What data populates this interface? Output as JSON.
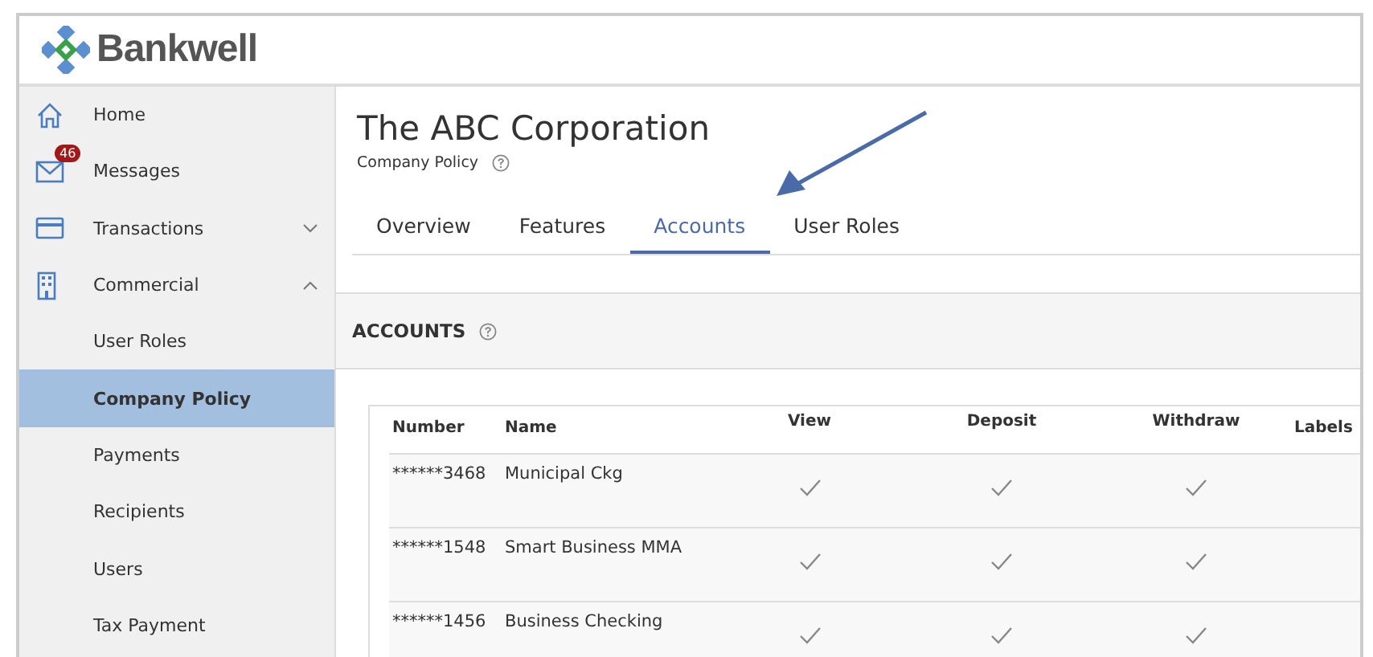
{
  "brand": {
    "name": "Bankwell"
  },
  "sidebar": {
    "items": [
      {
        "label": "Home",
        "kind": "home",
        "selected": false
      },
      {
        "label": "Messages",
        "kind": "mail",
        "badge": "46",
        "selected": false
      },
      {
        "label": "Transactions",
        "kind": "card",
        "expanded": false,
        "selected": false
      },
      {
        "label": "Commercial",
        "kind": "building",
        "expanded": true,
        "selected": false
      },
      {
        "label": "User Roles",
        "kind": "sub",
        "selected": false
      },
      {
        "label": "Company Policy",
        "kind": "sub",
        "selected": true
      },
      {
        "label": "Payments",
        "kind": "sub",
        "selected": false
      },
      {
        "label": "Recipients",
        "kind": "sub",
        "selected": false
      },
      {
        "label": "Users",
        "kind": "sub",
        "selected": false
      },
      {
        "label": "Tax Payment",
        "kind": "sub",
        "selected": false
      }
    ]
  },
  "page": {
    "title": "The ABC Corporation",
    "subtitle": "Company Policy"
  },
  "tabs": [
    {
      "label": "Overview",
      "selected": false
    },
    {
      "label": "Features",
      "selected": false
    },
    {
      "label": "Accounts",
      "selected": true
    },
    {
      "label": "User Roles",
      "selected": false
    }
  ],
  "section": {
    "title": "ACCOUNTS"
  },
  "table": {
    "columns": [
      "Number",
      "Name",
      "View",
      "Deposit",
      "Withdraw",
      "Labels"
    ],
    "rows": [
      {
        "number": "******3468",
        "name": "Municipal Ckg",
        "view": true,
        "deposit": true,
        "withdraw": true
      },
      {
        "number": "******1548",
        "name": "Smart Business MMA",
        "view": true,
        "deposit": true,
        "withdraw": true
      },
      {
        "number": "******1456",
        "name": "Business Checking",
        "view": true,
        "deposit": true,
        "withdraw": true
      }
    ]
  }
}
